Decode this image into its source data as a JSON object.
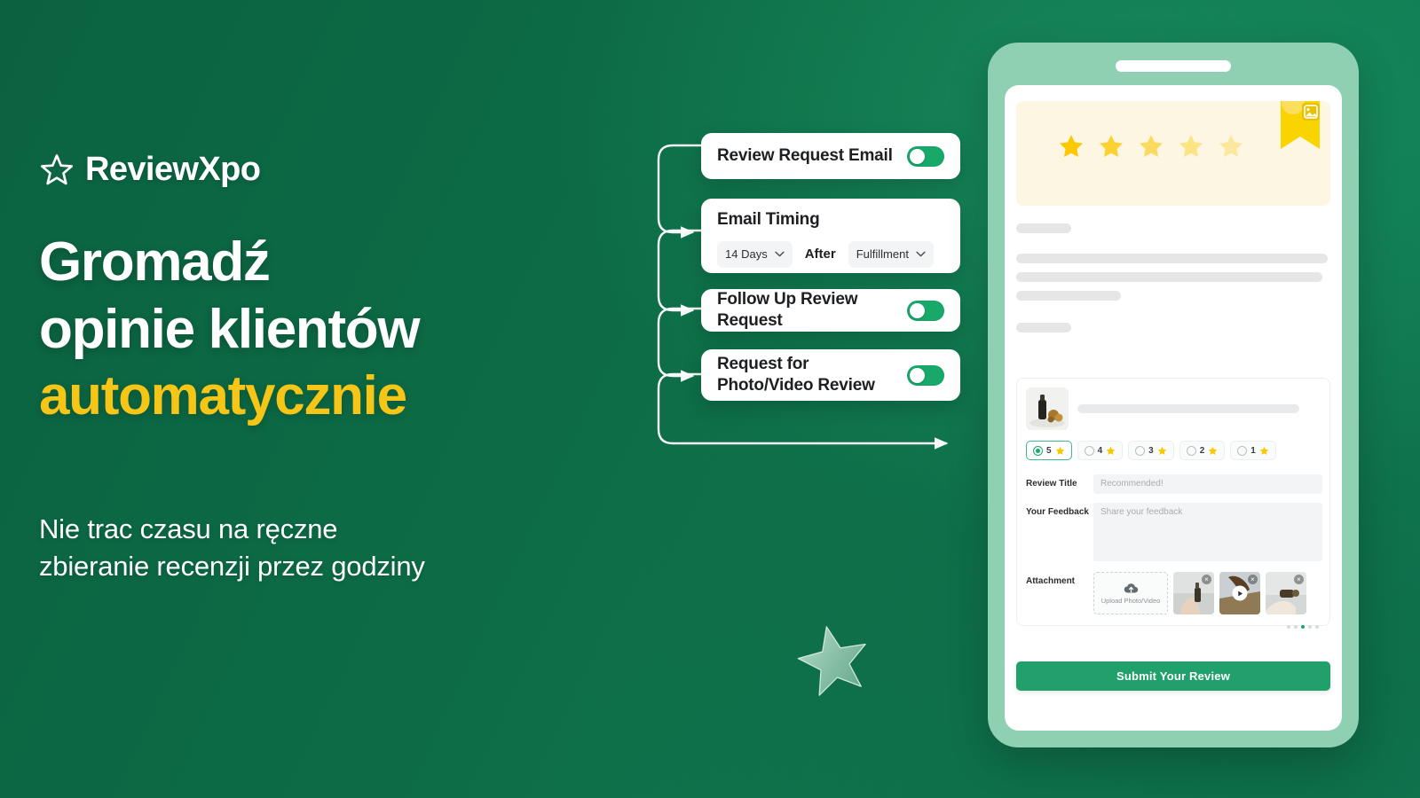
{
  "brand": {
    "name": "ReviewXpo",
    "logo_icon": "star-outline-icon",
    "accent_color": "#f5c518",
    "primary_color": "#17a86a",
    "background_color": "#0c6b45"
  },
  "hero": {
    "headline_lines": [
      "Gromadź",
      "opinie klientów",
      "automatycznie"
    ],
    "accent_line_index": 2,
    "subhead_lines": [
      "Nie trac czasu na ręczne",
      "zbieranie recenzji przez godziny"
    ]
  },
  "flow": {
    "cards": [
      {
        "title": "Review Request Email",
        "toggle": "on"
      },
      {
        "title": "Email Timing",
        "toggle": null
      },
      {
        "title": "Follow Up Review Request",
        "toggle": "on"
      },
      {
        "title": "Request for Photo/Video Review",
        "title_line_1": "Request for",
        "title_line_2": "Photo/Video Review",
        "toggle": "on"
      }
    ],
    "email_timing": {
      "delay_value": "14 Days",
      "connector_word": "After",
      "trigger_value": "Fulfillment",
      "caret_icon": "chevron-down-icon"
    }
  },
  "phone": {
    "banner": {
      "stars_count": 5,
      "star_icon": "star-filled-icon",
      "ribbon_icon": "bookmark-ribbon-icon",
      "ribbon_inner_icon": "image-icon",
      "background_color": "#fdf6e2"
    },
    "review_form": {
      "product_thumbnail_alt": "product-photo",
      "rating_options": [
        {
          "value": "5",
          "selected": true
        },
        {
          "value": "4",
          "selected": false
        },
        {
          "value": "3",
          "selected": false
        },
        {
          "value": "2",
          "selected": false
        },
        {
          "value": "1",
          "selected": false
        }
      ],
      "fields": [
        {
          "label": "Review Title",
          "placeholder": "Recommended!"
        },
        {
          "label": "Your Feedback",
          "placeholder": "Share your feedback"
        },
        {
          "label": "Attachment",
          "placeholder": ""
        }
      ],
      "upload": {
        "label": "Upload Photo/Video",
        "icon": "cloud-upload-icon",
        "thumbnails": [
          {
            "type": "photo",
            "removable": false
          },
          {
            "type": "video",
            "removable": true
          },
          {
            "type": "photo",
            "removable": true
          }
        ],
        "carousel_dots": 5,
        "carousel_active_index": 2
      },
      "submit_label": "Submit Your Review"
    }
  },
  "decor": {
    "star_icon": "star-decorative-icon"
  }
}
